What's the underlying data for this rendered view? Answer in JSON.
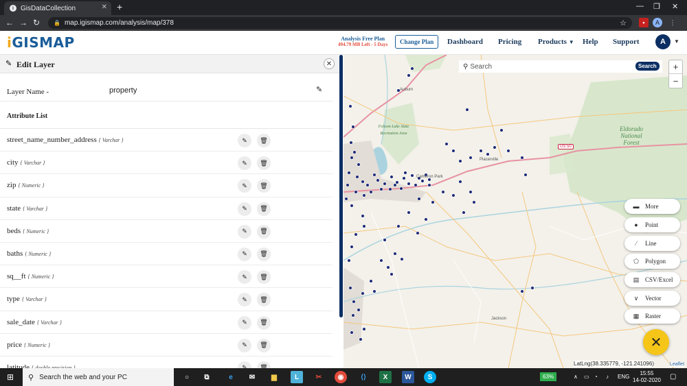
{
  "browser": {
    "tab_title": "GisDataCollection",
    "new_tab_icon": "+",
    "url": "map.igismap.com/analysis/map/378",
    "profile_initial": "A"
  },
  "header": {
    "logo_i": "i",
    "logo_rest": "GISMAP",
    "plan_title": "Analysis Free Plan",
    "plan_subtitle": "494.79 MB Left - 5 Days",
    "change_plan": "Change Plan",
    "menu": [
      "Dashboard",
      "Pricing",
      "Products",
      "Help",
      "Support"
    ],
    "user_initial": "A"
  },
  "panel": {
    "title": "Edit Layer",
    "layer_name_label": "Layer Name -",
    "layer_name_value": "property",
    "attribute_list_title": "Attribute List",
    "attributes": [
      {
        "name": "street_name_number_address",
        "type": "{ Varchar }"
      },
      {
        "name": "city",
        "type": "{ Varchar }"
      },
      {
        "name": "zip",
        "type": "{ Numeric }"
      },
      {
        "name": "state",
        "type": "{ Varchar }"
      },
      {
        "name": "beds",
        "type": "{ Numeric }"
      },
      {
        "name": "baths",
        "type": "{ Numeric }"
      },
      {
        "name": "sq__ft",
        "type": "{ Numeric }"
      },
      {
        "name": "type",
        "type": "{ Varchar }"
      },
      {
        "name": "sale_date",
        "type": "{ Varchar }"
      },
      {
        "name": "price",
        "type": "{ Numeric }"
      },
      {
        "name": "latitude",
        "type": "{ double precision }"
      }
    ]
  },
  "map": {
    "search_placeholder": "Search",
    "search_button": "Search",
    "zoom_in": "+",
    "zoom_out": "−",
    "tools": [
      {
        "label": "More",
        "icon": "more-icon"
      },
      {
        "label": "Point",
        "icon": "point-icon"
      },
      {
        "label": "Line",
        "icon": "line-icon"
      },
      {
        "label": "Polygon",
        "icon": "polygon-icon"
      },
      {
        "label": "CSV/Excel",
        "icon": "csv-icon"
      },
      {
        "label": "Vector",
        "icon": "vector-icon"
      },
      {
        "label": "Raster",
        "icon": "raster-icon"
      }
    ],
    "latlng": "LatLng(38.335779, -121.241096)",
    "attribution": "Leaflet",
    "labels": {
      "eldorado": "Eldorado National Forest",
      "folsom_lake": "Folsom Lake State Recreation Area",
      "auburn": "Auburn",
      "placerville": "Placerville",
      "jackson": "Jackson",
      "cameron": "Cameron Park",
      "us50": "US 50"
    },
    "marker_color": "#1e2a78"
  },
  "taskbar": {
    "search_text": "Search the web and your PC",
    "battery": "63%",
    "lang": "ENG",
    "time": "15:55",
    "date": "14-02-2020"
  },
  "colors": {
    "brand": "#1a5d99",
    "accent_dark": "#0c2f63",
    "fab": "#f5c518",
    "warning": "#e24b3b"
  }
}
